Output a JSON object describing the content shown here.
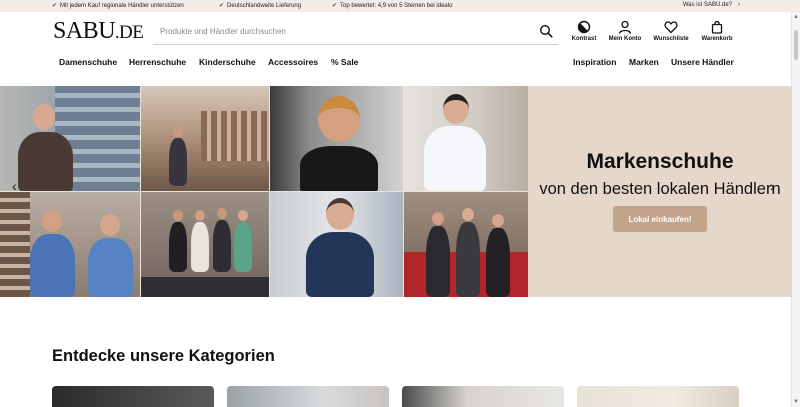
{
  "topbar": {
    "usp": [
      "Mit jedem Kauf regionale Händler unterstützen",
      "Deutschlandweite Lieferung",
      "Top bewertet: 4,9 von 5 Sternen bei idealo"
    ],
    "whatis": "Was ist SABU.de?",
    "whatis_arrow": "›"
  },
  "header": {
    "logo_main": "SABU",
    "logo_dot": ".",
    "logo_tld": "DE",
    "search_placeholder": "Produkte und Händler durchsuchen",
    "icons": [
      {
        "label": "Kontrast",
        "icon": "contrast-icon"
      },
      {
        "label": "Mein Konto",
        "icon": "user-icon"
      },
      {
        "label": "Wunschliste",
        "icon": "heart-icon"
      },
      {
        "label": "Warenkorb",
        "icon": "bag-icon"
      }
    ]
  },
  "nav": {
    "left": [
      "Damenschuhe",
      "Herrenschuhe",
      "Kinderschuhe",
      "Accessoires",
      "% Sale"
    ],
    "right": [
      "Inspiration",
      "Marken",
      "Unsere Händler"
    ]
  },
  "hero": {
    "title": "Markenschuhe",
    "subtitle": "von den besten lokalen Händlern",
    "cta": "Lokal einkaufen!",
    "prev": "‹",
    "next": "›"
  },
  "categories": {
    "title": "Entdecke unsere Kategorien"
  },
  "colors": {
    "accent": "#c1a48a",
    "hero_bg": "#e5d8cb",
    "topbar_bg": "#f1ece6"
  }
}
